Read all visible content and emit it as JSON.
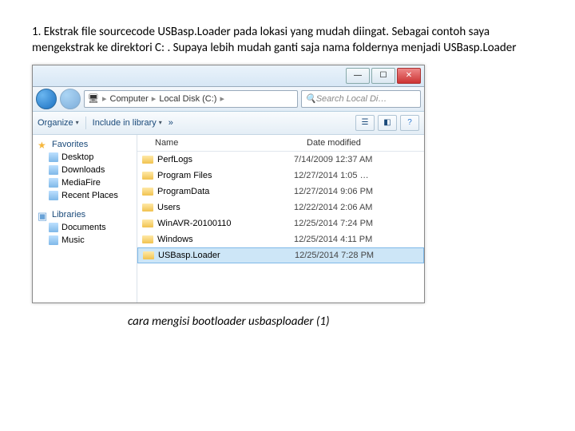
{
  "instruction": "1. Ekstrak file sourcecode USBasp.Loader pada lokasi yang mudah diingat. Sebagai contoh saya mengekstrak ke direktori C: . Supaya lebih mudah ganti saja nama foldernya menjadi USBasp.Loader",
  "caption": "cara mengisi bootloader usbasploader (1)",
  "address": {
    "p1": "Computer",
    "p2": "Local Disk (C:)"
  },
  "search": "Search Local Di…",
  "toolbar": {
    "organize": "Organize",
    "include": "Include in library",
    "more": "»"
  },
  "headers": {
    "name": "Name",
    "date": "Date modified"
  },
  "sidebar": {
    "fav": "Favorites",
    "items": [
      "Desktop",
      "Downloads",
      "MediaFire",
      "Recent Places"
    ],
    "lib": "Libraries",
    "libitems": [
      "Documents",
      "Music"
    ]
  },
  "files": [
    {
      "name": "PerfLogs",
      "date": "7/14/2009 12:37 AM"
    },
    {
      "name": "Program Files",
      "date": "12/27/2014 1:05 …"
    },
    {
      "name": "ProgramData",
      "date": "12/27/2014 9:06 PM"
    },
    {
      "name": "Users",
      "date": "12/22/2014 2:06 AM"
    },
    {
      "name": "WinAVR-20100110",
      "date": "12/25/2014 7:24 PM"
    },
    {
      "name": "Windows",
      "date": "12/25/2014 4:11 PM"
    },
    {
      "name": "USBasp.Loader",
      "date": "12/25/2014 7:28 PM",
      "sel": true
    }
  ]
}
